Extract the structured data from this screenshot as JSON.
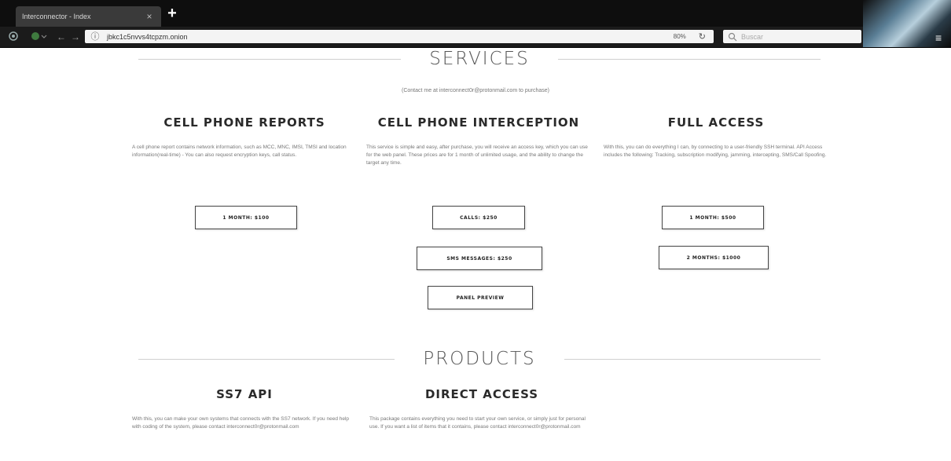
{
  "browser": {
    "tab_title": "Interconnector - Index",
    "tab_close": "×",
    "new_tab": "+",
    "url": "jbkc1c5nvvs4tcpzm.onion",
    "zoom": "80%",
    "search_placeholder": "Buscar"
  },
  "services": {
    "heading": "SERVICES",
    "contact": "(Contact me at interconnect0r@protonmail.com to purchase)",
    "columns": [
      {
        "title": "CELL PHONE REPORTS",
        "description": "A cell phone report contains network information, such as MCC, MNC, IMSI, TMSI and location information(real-time) - You can also request encryption keys, call status.",
        "buttons": [
          "1 MONTH: $100"
        ]
      },
      {
        "title": "CELL PHONE INTERCEPTION",
        "description": "This service is simple and easy, after purchase, you will receive an access key, which you can use for the web panel. These prices are for 1 month of unlimited usage, and the ability to change the target any time.",
        "buttons": [
          "CALLS: $250",
          "SMS MESSAGES: $250",
          "PANEL PREVIEW"
        ]
      },
      {
        "title": "FULL ACCESS",
        "description": "With this, you can do everything I can, by connecting to a user-friendly SSH terminal. API Access includes the following: Tracking, subscription modifying, jamming, intercepting, SMS/Call Spoofing.",
        "buttons": [
          "1 MONTH: $500",
          "2 MONTHS: $1000"
        ]
      }
    ]
  },
  "products": {
    "heading": "PRODUCTS",
    "columns": [
      {
        "title": "SS7 API",
        "description": "With this, you can make your own systems that connects with the SS7 network. If you need help with coding of the system, please contact interconnect0r@protonmail.com"
      },
      {
        "title": "DIRECT ACCESS",
        "description": "This package contains everything you need to start your own service, or simply just for personal use. If you want a list of items that it contains, please contact interconnect0r@protonmail.com"
      }
    ]
  }
}
